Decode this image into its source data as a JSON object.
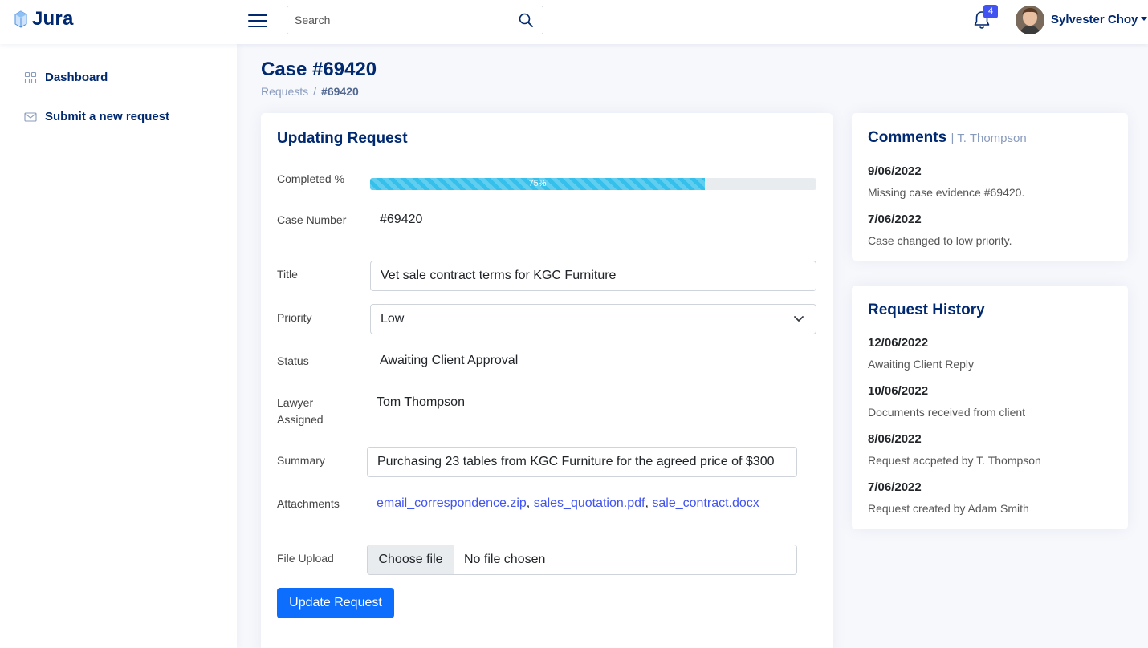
{
  "header": {
    "brand": "Jura",
    "search": {
      "placeholder": "Search",
      "value": ""
    },
    "notifications_count": "4",
    "user_name": "Sylvester Choy"
  },
  "sidebar": {
    "items": [
      {
        "label": "Dashboard",
        "icon": "grid-icon"
      },
      {
        "label": "Submit a new request",
        "icon": "envelope-icon"
      }
    ]
  },
  "page": {
    "title": "Case #69420",
    "breadcrumb": {
      "parent": "Requests",
      "separator": "/",
      "current": "#69420"
    }
  },
  "form": {
    "card_title": "Updating Request",
    "completed": {
      "label": "Completed %",
      "value": 75,
      "text": "75%"
    },
    "case_number": {
      "label": "Case Number",
      "value": "#69420"
    },
    "title": {
      "label": "Title",
      "value": "Vet sale contract terms for KGC Furniture"
    },
    "priority": {
      "label": "Priority",
      "value": "Low"
    },
    "status": {
      "label": "Status",
      "value": "Awaiting Client Approval"
    },
    "lawyer": {
      "label": "Lawyer Assigned",
      "value": "Tom Thompson"
    },
    "summary": {
      "label": "Summary",
      "value": "Purchasing 23 tables from KGC Furniture for the agreed price of $300"
    },
    "attachments": {
      "label": "Attachments",
      "files": [
        "email_correspondence.zip",
        "sales_quotation.pdf",
        "sale_contract.docx"
      ],
      "separator": ","
    },
    "file_upload": {
      "label": "File Upload",
      "button": "Choose file",
      "status": "No file chosen"
    },
    "submit_label": "Update Request"
  },
  "comments": {
    "title": "Comments",
    "subtitle": "| T. Thompson",
    "entries": [
      {
        "date": "9/06/2022",
        "text": "Missing case evidence #69420."
      },
      {
        "date": "7/06/2022",
        "text": "Case changed to low priority."
      }
    ]
  },
  "history": {
    "title": "Request History",
    "entries": [
      {
        "date": "12/06/2022",
        "text": "Awaiting Client Reply"
      },
      {
        "date": "10/06/2022",
        "text": "Documents received from client"
      },
      {
        "date": "8/06/2022",
        "text": "Request accpeted by T. Thompson"
      },
      {
        "date": "7/06/2022",
        "text": "Request created by Adam Smith"
      }
    ]
  },
  "colors": {
    "brand": "#012970",
    "accent": "#4154f1",
    "progress": "#35c0ec",
    "primary_button": "#0d6efd"
  }
}
